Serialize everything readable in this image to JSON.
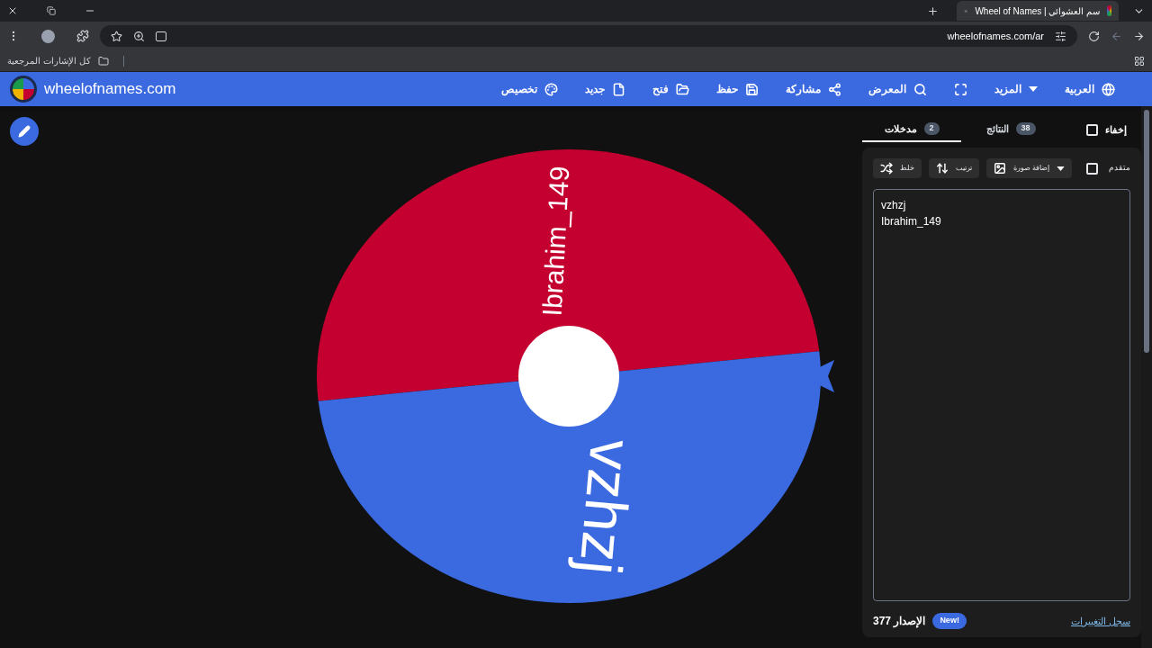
{
  "browser": {
    "tab_title": "Wheel of Names | سم العشوائي",
    "url": "wheelofnames.com/ar",
    "bookmarks_label": "كل الإشارات المرجعية"
  },
  "header": {
    "logo_text": "wheelofnames.com",
    "nav": [
      {
        "kind": "globe",
        "label": "العربية"
      },
      {
        "kind": "more",
        "label": "المزيد"
      },
      {
        "kind": "fullscreen"
      },
      {
        "kind": "search",
        "label": "المعرض"
      },
      {
        "kind": "share",
        "label": "مشاركة"
      },
      {
        "kind": "save",
        "label": "حفظ"
      },
      {
        "kind": "open",
        "label": "فتح"
      },
      {
        "kind": "new",
        "label": "جديد"
      },
      {
        "kind": "palette",
        "label": "تخصيص"
      }
    ]
  },
  "wheel": {
    "slices": [
      {
        "label": "Ibrahim_149",
        "color": "#c3002f"
      },
      {
        "label": "vzhzj",
        "color": "#3a69e0"
      }
    ]
  },
  "panel": {
    "tabs": [
      {
        "label": "النتائج",
        "count": "38",
        "selected": false
      },
      {
        "label": "مدخلات",
        "count": "2",
        "selected": true
      }
    ],
    "hide": {
      "label": "إخفاء",
      "checked": false
    },
    "toolbar": [
      {
        "kind": "image",
        "label": "إضافة صورة"
      },
      {
        "kind": "sort",
        "label": "ترتيب"
      },
      {
        "kind": "shuffle",
        "label": "خلط"
      }
    ],
    "advanced": {
      "label": "متقدم",
      "checked": false
    },
    "entries": [
      "vzhzj",
      "Ibrahim_149"
    ],
    "version": "الإصدار 377",
    "new_badge": "New!",
    "changelog_link": "سجل التغييرات"
  }
}
